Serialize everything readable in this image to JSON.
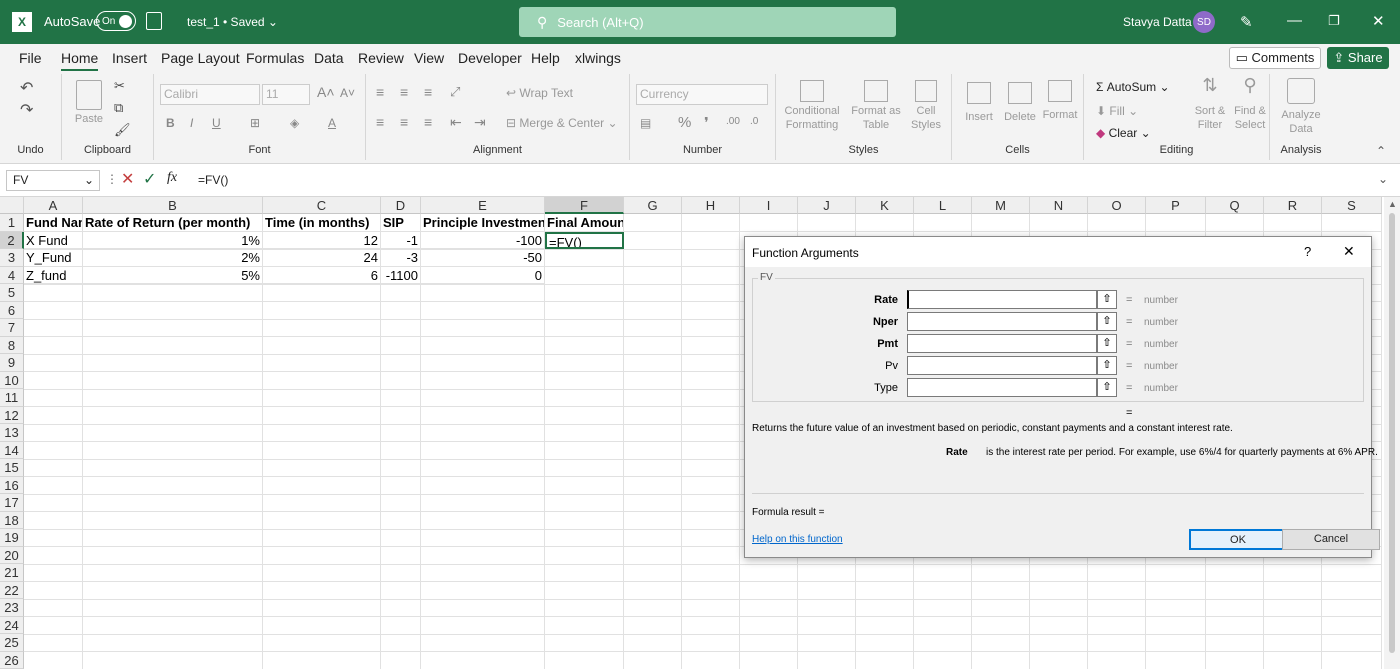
{
  "titlebar": {
    "autosave_label": "AutoSave",
    "autosave_state": "On",
    "doc_title": "test_1 • Saved",
    "search_placeholder": "Search (Alt+Q)",
    "user_name": "Stavya Datta",
    "user_initials": "SD"
  },
  "tabs": [
    "File",
    "Home",
    "Insert",
    "Page Layout",
    "Formulas",
    "Data",
    "Review",
    "View",
    "Developer",
    "Help",
    "xlwings"
  ],
  "actions": {
    "comments": "Comments",
    "share": "Share"
  },
  "ribbon": {
    "undo_group": "Undo",
    "clipboard_group": "Clipboard",
    "paste": "Paste",
    "font_group": "Font",
    "font_name": "Calibri",
    "font_size": "11",
    "alignment_group": "Alignment",
    "wrap_text": "Wrap Text",
    "merge_center": "Merge & Center",
    "number_group": "Number",
    "number_format": "Currency",
    "styles_group": "Styles",
    "conditional": "Conditional",
    "formatting": "Formatting",
    "format_as": "Format as",
    "table": "Table",
    "cell": "Cell",
    "styles": "Styles",
    "cells_group": "Cells",
    "insert": "Insert",
    "delete": "Delete",
    "format": "Format",
    "editing_group": "Editing",
    "autosum": "AutoSum",
    "fill": "Fill",
    "clear": "Clear",
    "sort_filter_1": "Sort &",
    "sort_filter_2": "Filter",
    "find_select_1": "Find &",
    "find_select_2": "Select",
    "analysis_group": "Analysis",
    "analyze_1": "Analyze",
    "analyze_2": "Data"
  },
  "formula_bar": {
    "name_box": "FV",
    "formula": "=FV()",
    "fx": "fx"
  },
  "columns": [
    "A",
    "B",
    "C",
    "D",
    "E",
    "F",
    "G",
    "H",
    "I",
    "J",
    "K",
    "L",
    "M",
    "N",
    "O",
    "P",
    "Q",
    "R",
    "S"
  ],
  "rows": [
    "1",
    "2",
    "3",
    "4",
    "5",
    "6",
    "7",
    "8",
    "9",
    "10",
    "11",
    "12",
    "13",
    "14",
    "15",
    "16",
    "17",
    "18",
    "19",
    "20",
    "21",
    "22",
    "23",
    "24",
    "25",
    "26"
  ],
  "sheet": {
    "headers": [
      "Fund Nam",
      "Rate of Return (per month)",
      "Time (in months)",
      "SIP",
      "Principle Investment",
      "Final Amount"
    ],
    "data": [
      [
        "X Fund",
        "1%",
        "12",
        "-1",
        "-100",
        "=FV()"
      ],
      [
        "Y_Fund",
        "2%",
        "24",
        "-3",
        "-50",
        ""
      ],
      [
        "Z_fund",
        "5%",
        "6",
        "-1100",
        "0",
        ""
      ]
    ]
  },
  "dialog": {
    "title": "Function Arguments",
    "help_q": "?",
    "close": "✕",
    "func": "FV",
    "args": [
      {
        "name": "Rate",
        "type": "number"
      },
      {
        "name": "Nper",
        "type": "number"
      },
      {
        "name": "Pmt",
        "type": "number"
      },
      {
        "name": "Pv",
        "type": "number"
      },
      {
        "name": "Type",
        "type": "number"
      }
    ],
    "eq": "=",
    "description": "Returns the future value of an investment based on periodic, constant payments and a constant interest rate.",
    "arg_help_name": "Rate",
    "arg_help": "is the interest rate per period. For example, use 6%/4 for quarterly payments at 6% APR.",
    "formula_result": "Formula result =",
    "help_link": "Help on this function",
    "ok": "OK",
    "cancel": "Cancel"
  },
  "colors": {
    "excel_green": "#217346",
    "search_bg": "#9fd5b7",
    "avatar": "#8e6ac9"
  }
}
